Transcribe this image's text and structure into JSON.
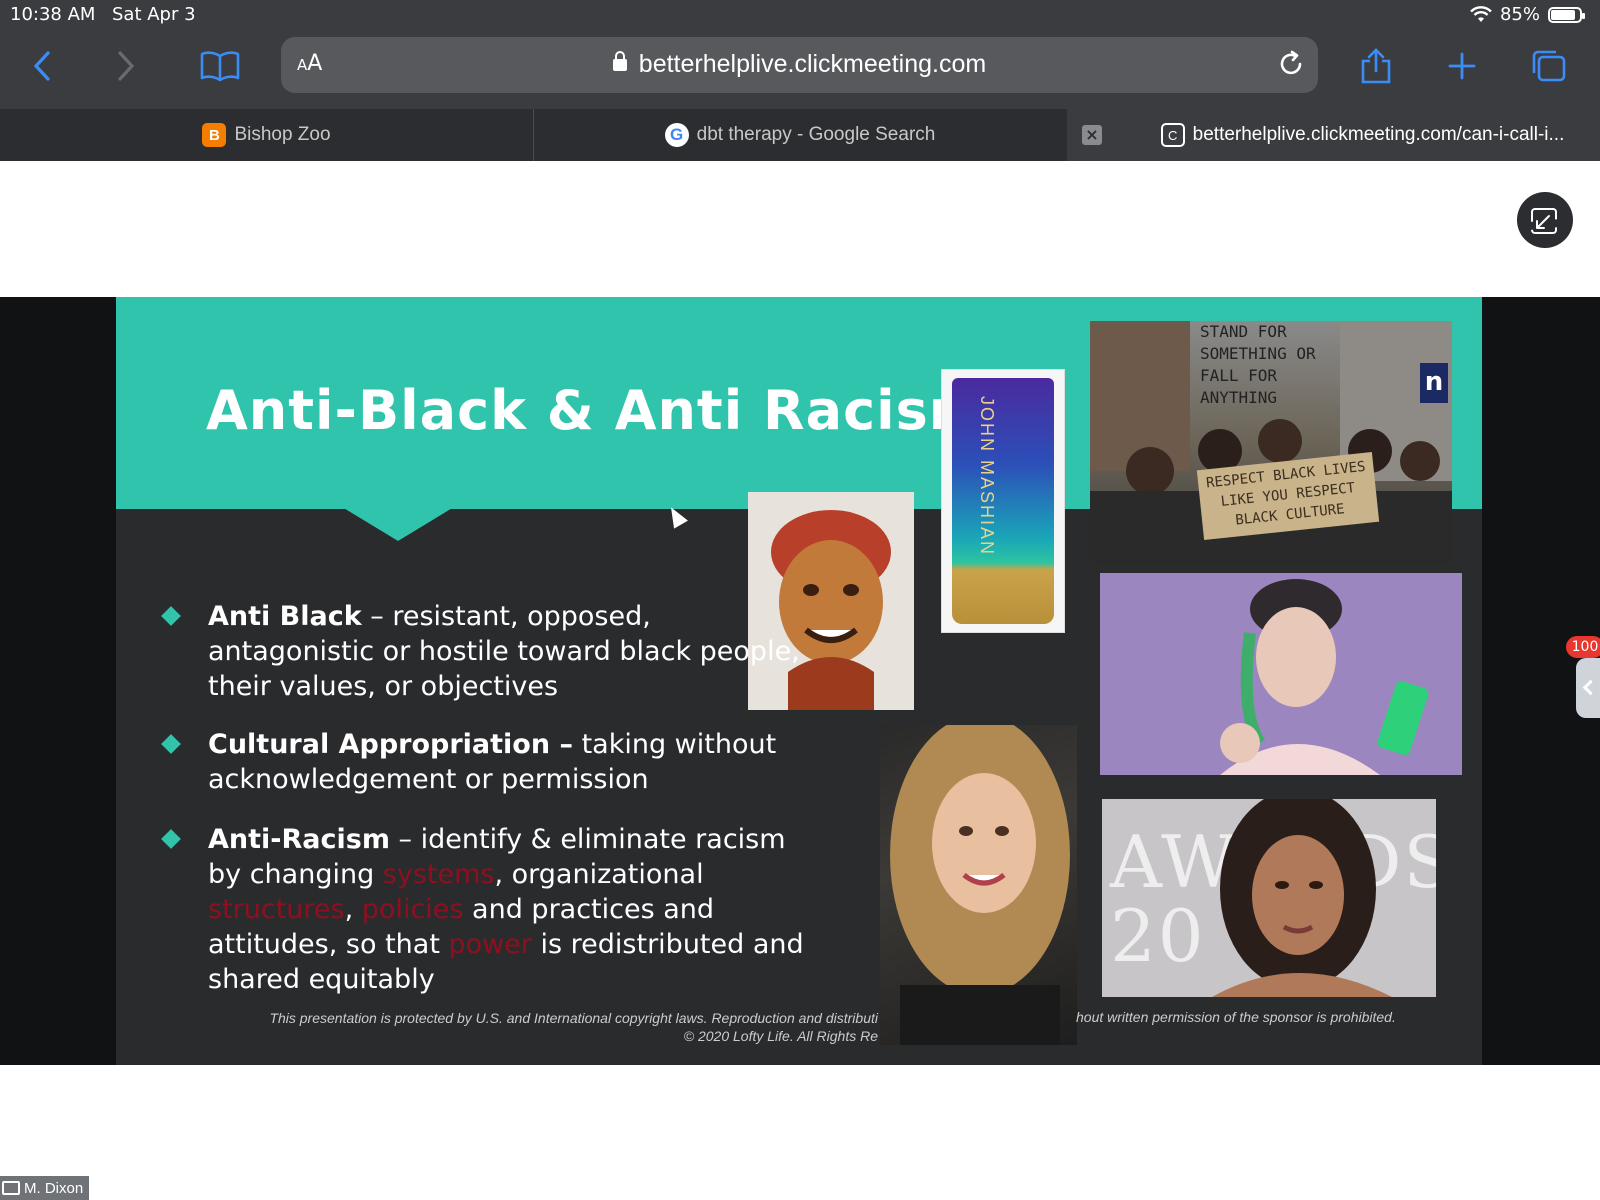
{
  "status": {
    "time": "10:38 AM",
    "date": "Sat Apr 3",
    "battery": "85%"
  },
  "browser": {
    "aa_label": "AA",
    "url": "betterhelplive.clickmeeting.com",
    "tabs": [
      {
        "label": "Bishop Zoo",
        "icon": "blogger-icon"
      },
      {
        "label": "dbt therapy - Google Search",
        "icon": "google-icon"
      },
      {
        "label": "betterhelplive.clickmeeting.com/can-i-call-i...",
        "icon": "clickmeeting-icon",
        "active": true
      }
    ]
  },
  "slide": {
    "title": "Anti-Black & Anti Racism",
    "bullets": [
      {
        "term": "Anti Black",
        "text": " – resistant, opposed, antagonistic or hostile toward black people, their values, or objectives"
      },
      {
        "term": "Cultural Appropriation –",
        "text": " taking without acknowledgement or permission"
      },
      {
        "term": "Anti-Racism",
        "text_a": " – identify & eliminate racism by changing ",
        "red_a": "systems",
        "text_b": ", organizational ",
        "red_b": "structures",
        "text_c": ", ",
        "red_c": "policies",
        "text_d": " and practices and attitudes, so that ",
        "red_d": "power",
        "text_e": " is redistributed and shared equitably"
      }
    ],
    "footer_left": "This presentation is protected by U.S. and International copyright laws. Reproduction and distributi",
    "footer_left2": "© 2020 Lofty Life. All Rights Re",
    "footer_right": "hout written permission of the sponsor is prohibited.",
    "protest_sign": "RESPECT BLACK LIVES LIKE YOU RESPECT BLACK CULTURE",
    "protest_sign2": "STAND FOR SOMETHING OR FALL FOR ANYTHING",
    "protest_badge": "n",
    "lotion_label": "JOHN MASHIAN",
    "awards_text": "AWARDS 20"
  },
  "overlay": {
    "badge_count": "100",
    "presenter": "M. Dixon"
  }
}
